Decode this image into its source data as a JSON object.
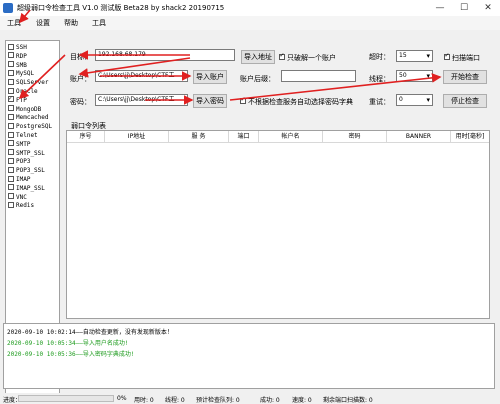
{
  "window": {
    "title": "超级弱口令检查工具 V1.0 测试版 Beta28 by shack2 20190715",
    "minimize": "—",
    "maximize": "☐",
    "close": "✕"
  },
  "menu": [
    "工具",
    "设置",
    "帮助",
    "工具"
  ],
  "services": [
    {
      "label": "SSH",
      "checked": false
    },
    {
      "label": "RDP",
      "checked": false
    },
    {
      "label": "SMB",
      "checked": false
    },
    {
      "label": "MySQL",
      "checked": false
    },
    {
      "label": "SQLServer",
      "checked": false
    },
    {
      "label": "Oracle",
      "checked": false
    },
    {
      "label": "FTP",
      "checked": true
    },
    {
      "label": "MongoDB",
      "checked": false
    },
    {
      "label": "Memcached",
      "checked": false
    },
    {
      "label": "PostgreSQL",
      "checked": false
    },
    {
      "label": "Telnet",
      "checked": false
    },
    {
      "label": "SMTP",
      "checked": false
    },
    {
      "label": "SMTP_SSL",
      "checked": false
    },
    {
      "label": "POP3",
      "checked": false
    },
    {
      "label": "POP3_SSL",
      "checked": false
    },
    {
      "label": "IMAP",
      "checked": false
    },
    {
      "label": "IMAP_SSL",
      "checked": false
    },
    {
      "label": "VNC",
      "checked": false
    },
    {
      "label": "Redis",
      "checked": false
    }
  ],
  "form": {
    "target_label": "目标：",
    "target_value": "192.168.68.179",
    "import_address": "导入地址",
    "single_account_label": "只破解一个账户",
    "single_account_checked": true,
    "timeout_label": "超时：",
    "timeout_value": "15",
    "scan_port_label": "扫描端口",
    "scan_port_checked": true,
    "account_label": "账户：",
    "account_value": "C:\\Users\\jj\\Desktop\\CTF工",
    "import_account": "导入账户",
    "account_suffix_label": "账户后缀：",
    "account_suffix_value": "",
    "threads_label": "线程：",
    "threads_value": "50",
    "start_check": "开始检查",
    "password_label": "密码：",
    "password_value": "C:\\Users\\jj\\Desktop\\CTF工",
    "import_password": "导入密码",
    "weak_dict_label": "不根据检查服务自动选择密码字典",
    "weak_dict_checked": true,
    "retry_label": "重试：",
    "retry_value": "0",
    "stop_check": "停止检查"
  },
  "table": {
    "title": "弱口令列表",
    "columns": [
      "序号",
      "IP地址",
      "服 务",
      "端口",
      "帐户名",
      "密码",
      "BANNER",
      "用时[毫秒]"
    ]
  },
  "log": [
    {
      "text": "2020-09-10 10:02:14——自动检查更新，没有发现新版本！",
      "color": "#000000"
    },
    {
      "text": "2020-09-10 10:05:34——导入用户名成功!",
      "color": "#1a9a1a"
    },
    {
      "text": "2020-09-10 10:05:36——导入密码字典成功!",
      "color": "#1a9a1a"
    }
  ],
  "status": {
    "progress_label": "进度：",
    "progress_value": 0,
    "progress_text": "0%",
    "elapsed": "用时:  0",
    "threads": "线程:  0",
    "queue": "预计检查队列:  0",
    "success": "成功:  0",
    "speed": "速度:  0",
    "remaining": "剩余端口扫描数:  0"
  },
  "colors": {
    "annotation_arrow": "#e02020",
    "log_success": "#1a9a1a"
  }
}
